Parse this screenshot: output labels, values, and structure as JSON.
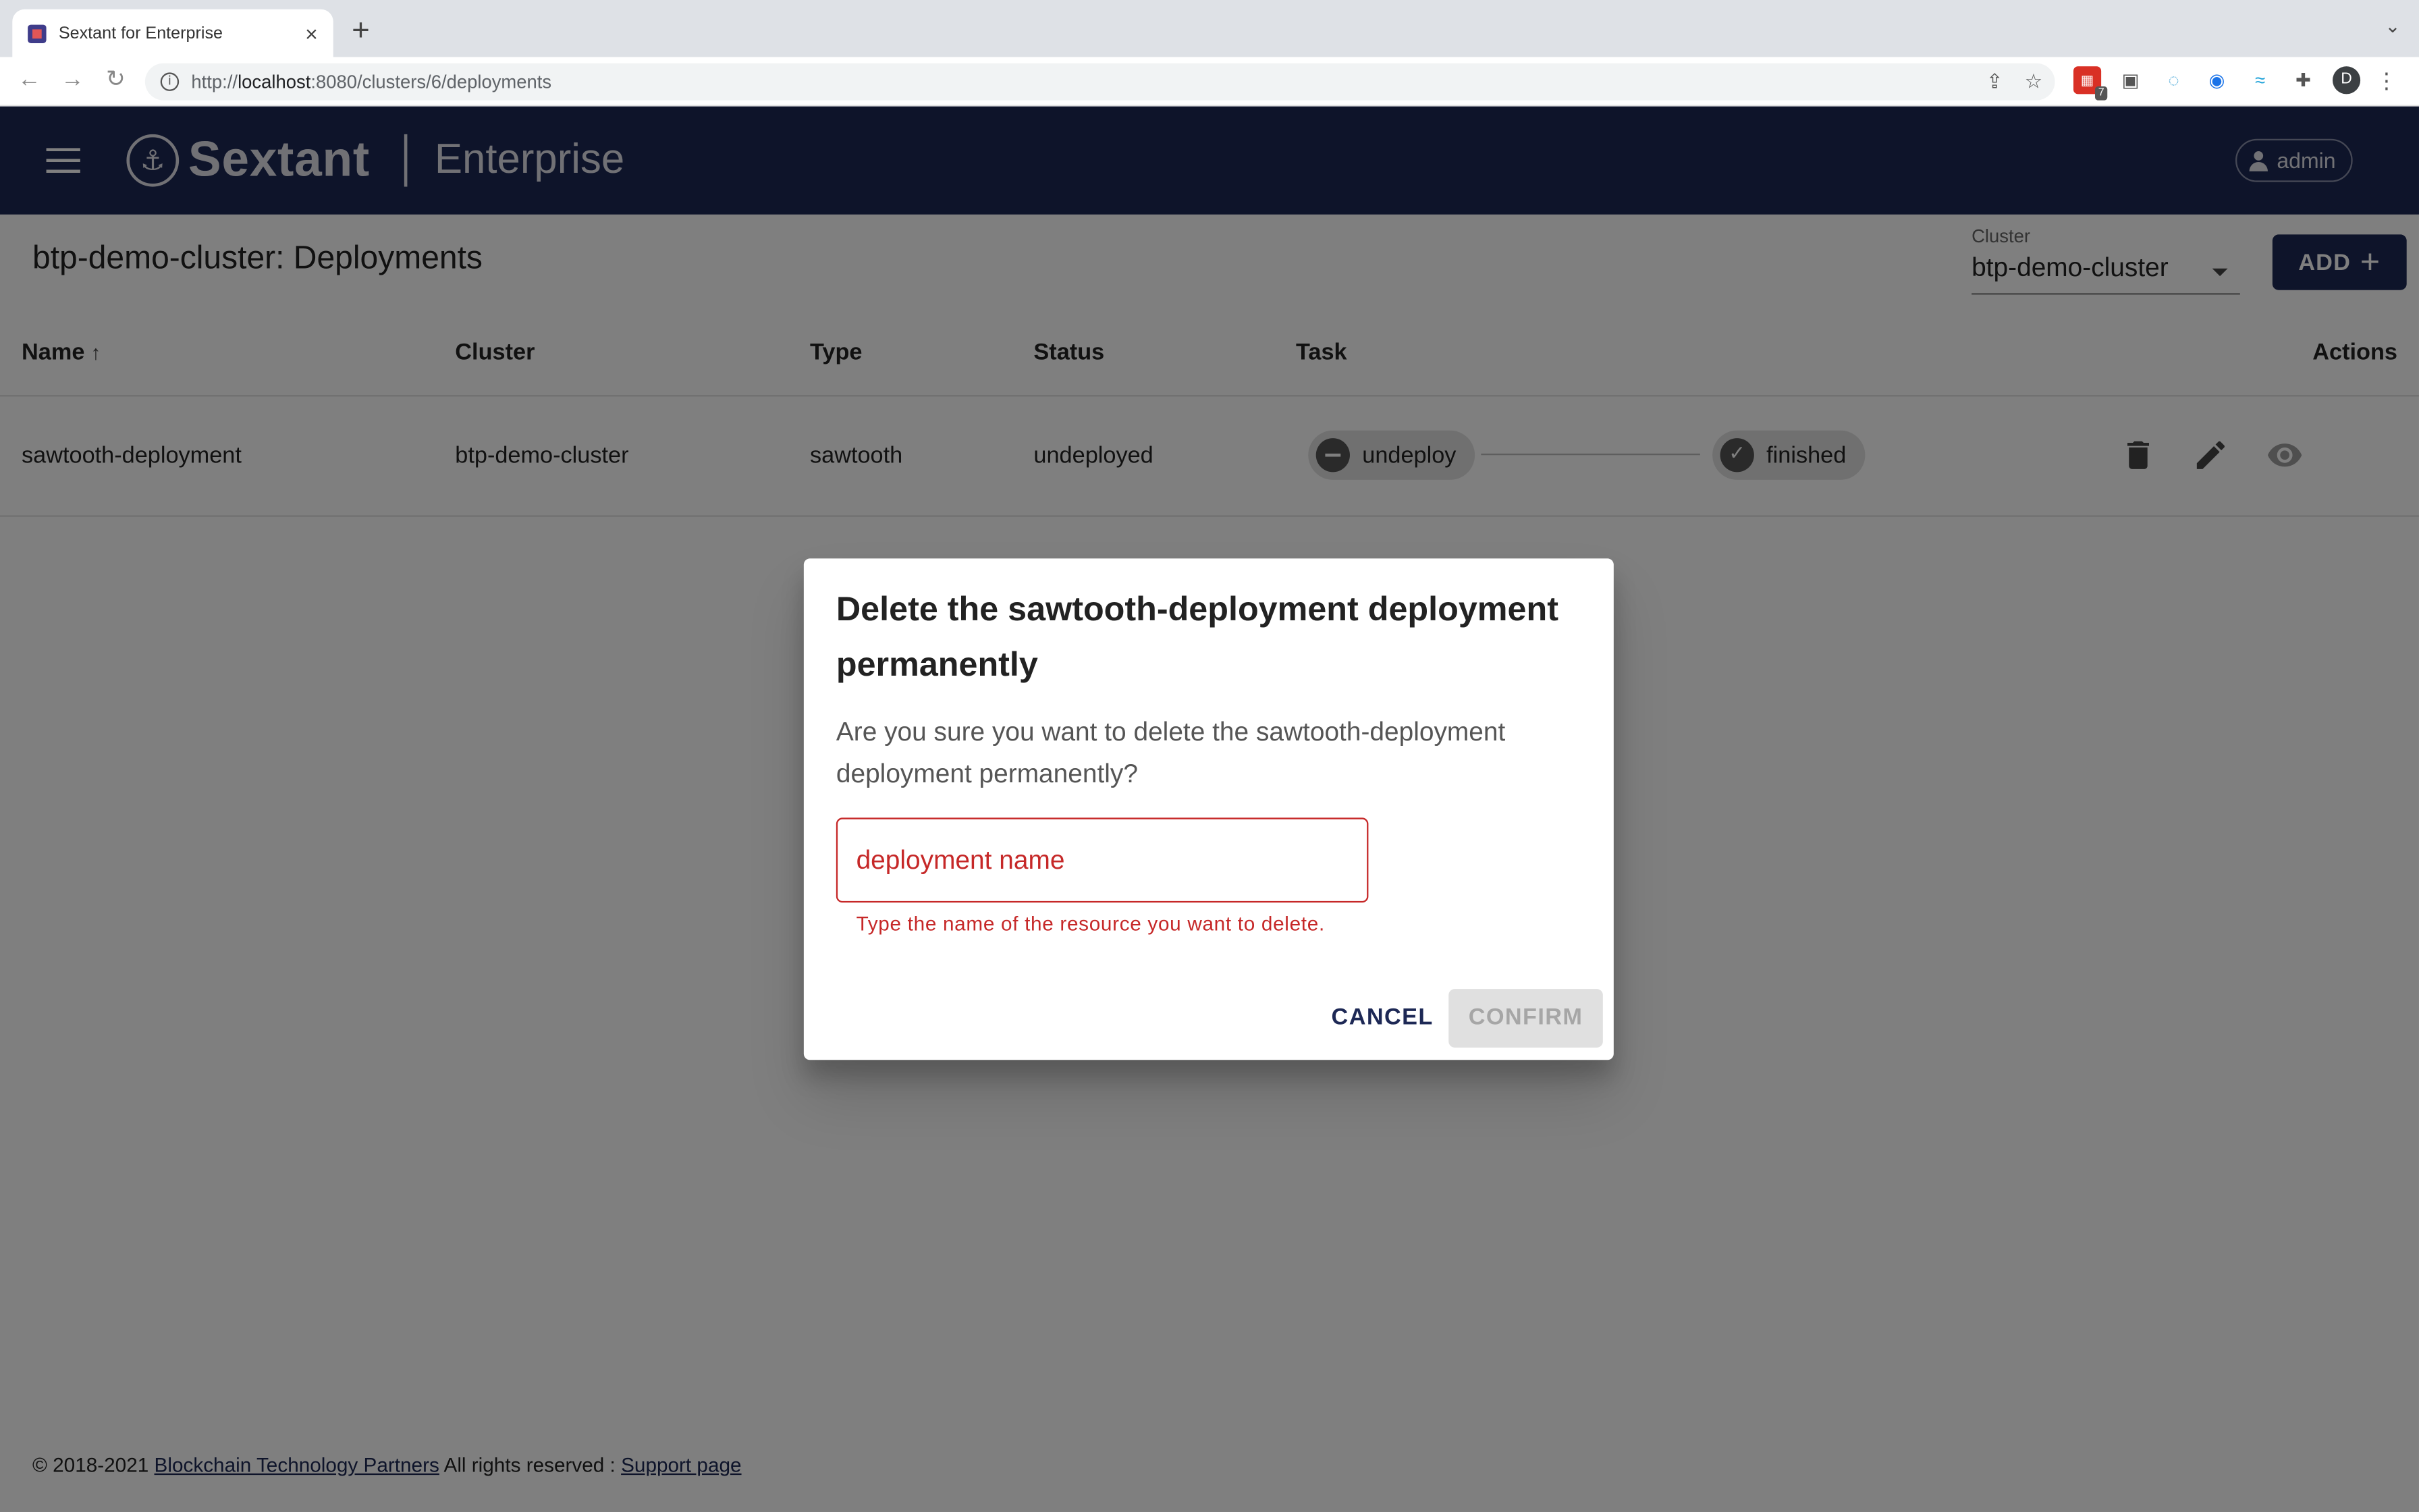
{
  "browser": {
    "tab_title": "Sextant for Enterprise",
    "tab_close": "×",
    "new_tab": "+",
    "tab_overflow": "⌄",
    "url_prefix": "http://",
    "url_host": "localhost",
    "url_path": ":8080/clusters/6/deployments",
    "profile_initial": "D",
    "extension_badge": "7"
  },
  "appbar": {
    "brand": "Sextant",
    "product": "Enterprise",
    "user": "admin"
  },
  "page": {
    "title": "btp-demo-cluster: Deployments",
    "cluster_label": "Cluster",
    "cluster_value": "btp-demo-cluster",
    "add_label": "ADD"
  },
  "table": {
    "columns": [
      "Name",
      "Cluster",
      "Type",
      "Status",
      "Task",
      "Actions"
    ],
    "rows": [
      {
        "name": "sawtooth-deployment",
        "cluster": "btp-demo-cluster",
        "type": "sawtooth",
        "status": "undeployed",
        "task_action": "undeploy",
        "task_state": "finished"
      }
    ]
  },
  "dialog": {
    "title": "Delete the sawtooth-deployment deployment permanently",
    "message": "Are you sure you want to delete the sawtooth-deployment deployment permanently?",
    "input_placeholder": "deployment name",
    "helper_text": "Type the name of the resource you want to delete.",
    "cancel_label": "CANCEL",
    "confirm_label": "CONFIRM"
  },
  "footer": {
    "copyright": "© 2018-2021",
    "company_link": "Blockchain Technology Partners",
    "rights": "All rights reserved :",
    "support_link": "Support page"
  },
  "colors": {
    "appbar": "#1d2855",
    "error": "#c62828",
    "primary": "#1d2855"
  }
}
